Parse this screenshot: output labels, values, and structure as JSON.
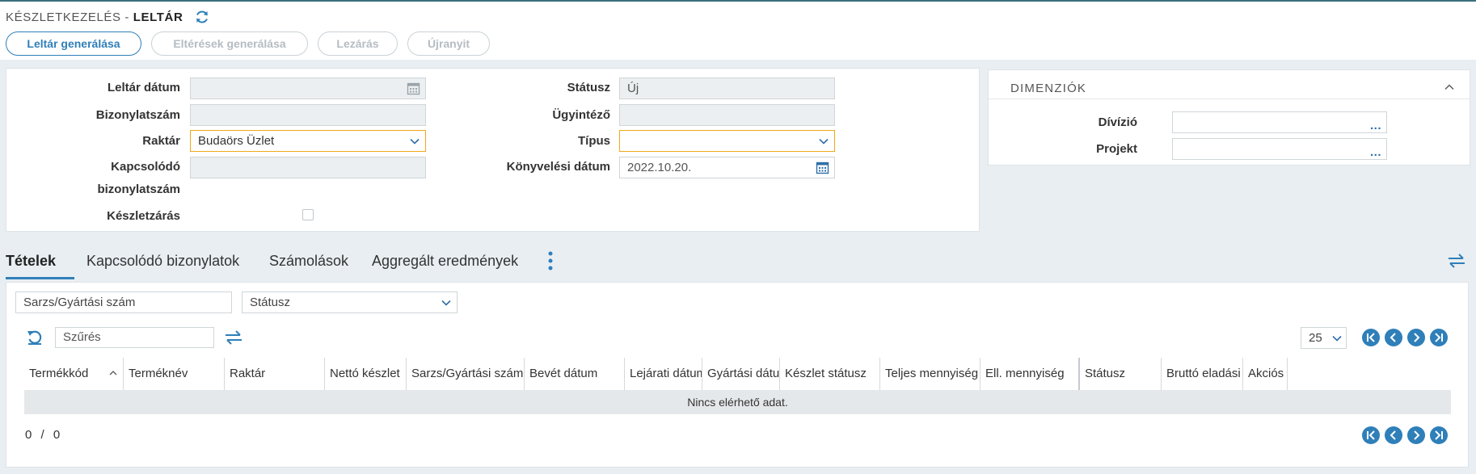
{
  "header": {
    "breadcrumb_parent": "KÉSZLETKEZELÉS -",
    "breadcrumb_current": "LELTÁR",
    "buttons": {
      "generate_inventory": "Leltár generálása",
      "generate_differences": "Eltérések generálása",
      "close": "Lezárás",
      "reopen": "Újranyit"
    }
  },
  "form": {
    "inventory_date_label": "Leltár dátum",
    "inventory_date_value": "",
    "doc_number_label": "Bizonylatszám",
    "doc_number_value": "",
    "warehouse_label": "Raktár",
    "warehouse_value": "Budaörs Üzlet",
    "related_doc_label_1": "Kapcsolódó",
    "related_doc_label_2": "bizonylatszám",
    "related_doc_value": "",
    "stock_closing_label": "Készletzárás",
    "status_label": "Státusz",
    "status_value": "Új",
    "handler_label": "Ügyintéző",
    "handler_value": "",
    "type_label": "Típus",
    "type_value": "",
    "posting_date_label": "Könyvelési dátum",
    "posting_date_value": "2022.10.20."
  },
  "dimensions": {
    "title": "DIMENZIÓK",
    "division_label": "Dívízió",
    "project_label": "Projekt",
    "dots": "..."
  },
  "tabs": [
    {
      "label": "Tételek"
    },
    {
      "label": "Kapcsolódó bizonylatok"
    },
    {
      "label": "Számolások"
    },
    {
      "label": "Aggregált eredmények"
    }
  ],
  "grid": {
    "batch_filter_placeholder": "Sarzs/Gyártási szám",
    "status_filter": "Státusz",
    "search_placeholder": "Szűrés",
    "page_size": "25",
    "columns": [
      "Termékkód",
      "Terméknév",
      "Raktár",
      "Nettó készlet",
      "Sarzs/Gyártási szám",
      "Bevét dátum",
      "Lejárati dátum",
      "Gyártási dátum",
      "Készlet státusz",
      "Teljes mennyiség",
      "Ell. mennyiség",
      "Státusz",
      "Bruttó eladási ár",
      "Akciós"
    ],
    "empty_text": "Nincs elérhető adat.",
    "pager_current": "0",
    "pager_sep": "/",
    "pager_total": "0"
  },
  "colors": {
    "accent": "#2f7fb9",
    "required_border": "#f0a81c"
  }
}
